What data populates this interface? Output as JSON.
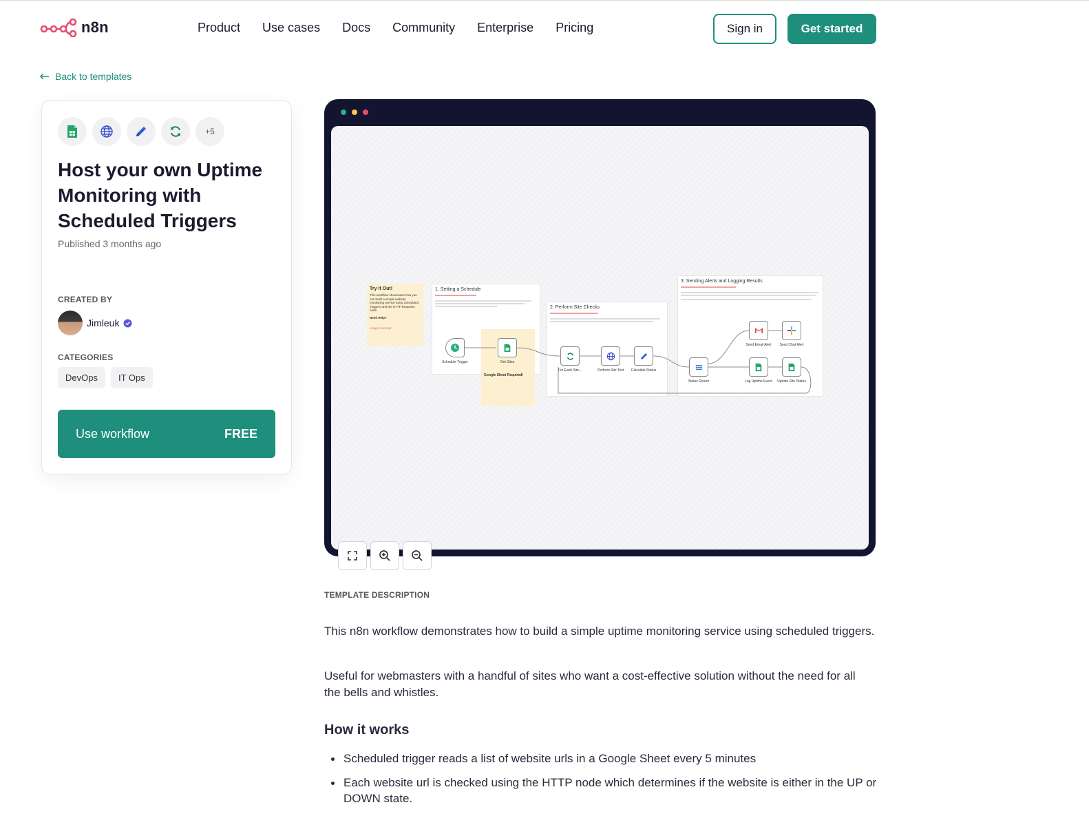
{
  "brand": {
    "name": "n8n",
    "logo_color": "#ea4b71"
  },
  "nav": {
    "items": [
      "Product",
      "Use cases",
      "Docs",
      "Community",
      "Enterprise",
      "Pricing"
    ],
    "sign_in": "Sign in",
    "get_started": "Get started"
  },
  "back_link": "Back to templates",
  "template": {
    "integration_icons": [
      "google-sheets-icon",
      "globe-icon",
      "pencil-icon",
      "refresh-icon"
    ],
    "more_count": "+5",
    "title": "Host your own Uptime Monitoring with Scheduled Triggers",
    "published": "Published 3 months ago",
    "created_by_label": "CREATED BY",
    "author": "Jimleuk",
    "categories_label": "CATEGORIES",
    "categories": [
      "DevOps",
      "IT Ops"
    ],
    "use_label": "Use workflow",
    "price": "FREE"
  },
  "workflow_preview": {
    "sticky_notes": {
      "try_title": "Try It Out!",
      "try_body": "This workflow showcases how you can build a simple website monitoring service using Scheduled Triggers and the HTTP Requests node.",
      "try_help": "Need Help?",
      "try_footer": "Happy Hacking!",
      "step1": "1. Setting a Schedule",
      "step2": "2. Perform Site Checks",
      "step3": "3. Sending Alerts and Logging Results",
      "sheet_note": "Google Sheet Required!"
    },
    "nodes": {
      "schedule": "Schedule Trigger",
      "get_sites": "Get Sites",
      "for_each": "For Each Site...",
      "site_test": "Perform Site Test",
      "calc_status": "Calculate Status",
      "router": "Status Router",
      "email": "Send Email Alert",
      "chat": "Send Chat Alert",
      "log": "Log Uptime Event",
      "update": "Update Site Status"
    }
  },
  "description": {
    "label": "TEMPLATE DESCRIPTION",
    "p1": "This n8n workflow demonstrates how to build a simple uptime monitoring service using scheduled triggers.",
    "p2": "Useful for webmasters with a handful of sites who want a cost-effective solution without the need for all the bells and whistles.",
    "how_title": "How it works",
    "how_items": [
      "Scheduled trigger reads a list of website urls in a Google Sheet every 5 minutes",
      "Each website url is checked using the HTTP node which determines if the website is either in the UP or DOWN state."
    ]
  },
  "colors": {
    "accent": "#1e8f7c",
    "frame": "#131530",
    "sticky": "#fdf0d0"
  }
}
